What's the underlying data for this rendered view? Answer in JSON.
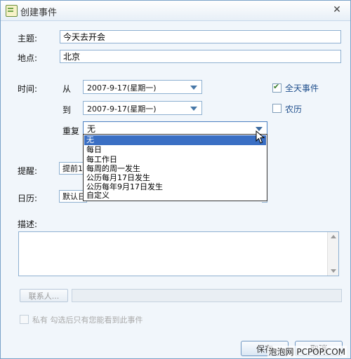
{
  "window": {
    "title": "创建事件",
    "close_glyph": "✕"
  },
  "form": {
    "subject_label": "主题:",
    "subject_value": "今天去开会",
    "location_label": "地点:",
    "location_value": "北京",
    "time_label": "时间:",
    "from_label": "从",
    "from_date": "2007-9-17(星期一)",
    "to_label": "到",
    "to_date": "2007-9-17(星期一)",
    "all_day_label": "全天事件",
    "all_day_checked": true,
    "lunar_label": "农历",
    "lunar_checked": false,
    "repeat_label": "重复",
    "repeat_value": "无",
    "reminder_label": "提醒:",
    "reminder_value_partial": "提前1",
    "calendar_label": "日历:",
    "calendar_value_partial": "默认日",
    "description_label": "描述:"
  },
  "repeat_options": [
    {
      "label": "无",
      "selected": true
    },
    {
      "label": "每日",
      "selected": false
    },
    {
      "label": "每工作日",
      "selected": false
    },
    {
      "label": "每周的周一发生",
      "selected": false
    },
    {
      "label": "公历每月17日发生",
      "selected": false
    },
    {
      "label": "公历每年9月17日发生",
      "selected": false
    },
    {
      "label": "自定义",
      "selected": false
    }
  ],
  "contacts": {
    "button_label": "联系人..."
  },
  "private": {
    "label": "私有  勾选后只有您能看到此事件"
  },
  "buttons": {
    "save": "保存",
    "cancel": "取消"
  },
  "watermark": "泡泡网 PCPOP.COM",
  "colors": {
    "accent": "#3a6fc4",
    "border": "#8eb0d1",
    "check_label": "#1e4e8c"
  }
}
